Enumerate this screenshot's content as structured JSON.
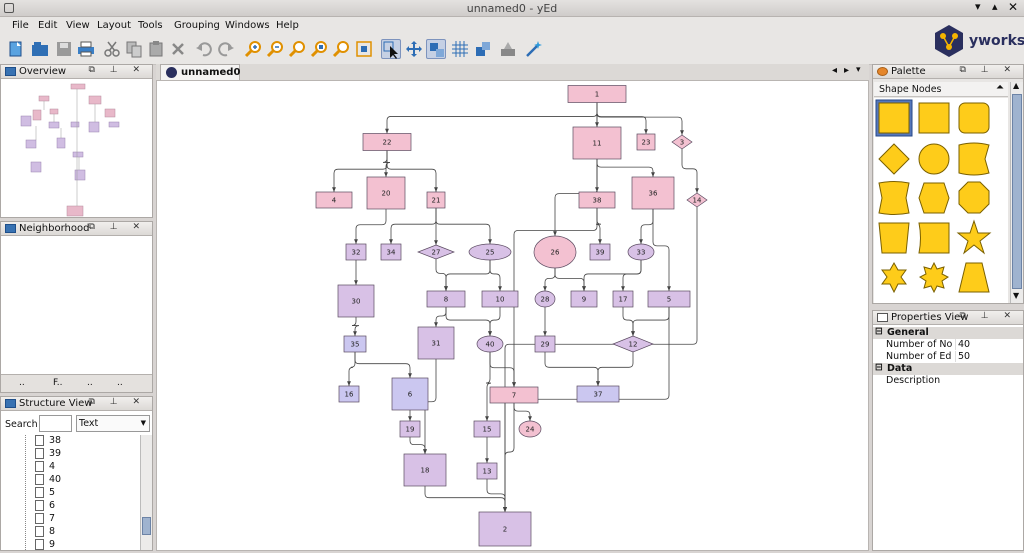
{
  "window": {
    "title": "unnamed0 - yEd"
  },
  "menu": [
    "File",
    "Edit",
    "View",
    "Layout",
    "Tools",
    "Grouping",
    "Windows",
    "Help"
  ],
  "brand": {
    "logo_text": "yworks"
  },
  "document_tab": {
    "label": "unnamed0"
  },
  "panels": {
    "overview": {
      "title": "Overview"
    },
    "neighborhood": {
      "title": "Neighborhood",
      "bottom_tabs": [
        "..",
        "F..",
        "..",
        ".."
      ]
    },
    "structure": {
      "title": "Structure View",
      "search_label": "Search",
      "search_value": "",
      "filter_value": "Text",
      "items": [
        "38",
        "39",
        "4",
        "40",
        "5",
        "6",
        "7",
        "8",
        "9"
      ]
    },
    "palette": {
      "title": "Palette",
      "section": "Shape Nodes"
    },
    "properties": {
      "title": "Properties View",
      "groups": [
        {
          "name": "General",
          "rows": [
            {
              "key": "Number of No...",
              "value": "40"
            },
            {
              "key": "Number of Ed...",
              "value": "50"
            }
          ]
        },
        {
          "name": "Data",
          "rows": [
            {
              "key": "Description",
              "value": ""
            }
          ]
        }
      ]
    }
  },
  "colors": {
    "pink": "#f3c1d1",
    "violet": "#d8c1e6",
    "blue": "#cbc7f0",
    "edge": "#444444",
    "accent": "#3872b2"
  },
  "graph": {
    "nodes": [
      {
        "id": "1",
        "shape": "rect",
        "color": "pink"
      },
      {
        "id": "22",
        "shape": "rect",
        "color": "pink"
      },
      {
        "id": "11",
        "shape": "rect",
        "color": "pink"
      },
      {
        "id": "23",
        "shape": "rect",
        "color": "pink"
      },
      {
        "id": "3",
        "shape": "diamond",
        "color": "pink"
      },
      {
        "id": "4",
        "shape": "rect",
        "color": "pink"
      },
      {
        "id": "20",
        "shape": "rect",
        "color": "pink"
      },
      {
        "id": "21",
        "shape": "rect",
        "color": "pink"
      },
      {
        "id": "38",
        "shape": "rect",
        "color": "pink"
      },
      {
        "id": "36",
        "shape": "rect",
        "color": "pink"
      },
      {
        "id": "14",
        "shape": "diamond",
        "color": "pink"
      },
      {
        "id": "32",
        "shape": "rect",
        "color": "violet"
      },
      {
        "id": "34",
        "shape": "rect",
        "color": "violet"
      },
      {
        "id": "27",
        "shape": "diamond",
        "color": "violet"
      },
      {
        "id": "25",
        "shape": "ellipse",
        "color": "violet"
      },
      {
        "id": "26",
        "shape": "ellipse",
        "color": "pink"
      },
      {
        "id": "39",
        "shape": "rect",
        "color": "violet"
      },
      {
        "id": "33",
        "shape": "ellipse",
        "color": "violet"
      },
      {
        "id": "30",
        "shape": "rect",
        "color": "violet"
      },
      {
        "id": "8",
        "shape": "rect",
        "color": "violet"
      },
      {
        "id": "10",
        "shape": "rect",
        "color": "violet"
      },
      {
        "id": "28",
        "shape": "ellipse",
        "color": "violet"
      },
      {
        "id": "9",
        "shape": "rect",
        "color": "violet"
      },
      {
        "id": "17",
        "shape": "rect",
        "color": "violet"
      },
      {
        "id": "5",
        "shape": "rect",
        "color": "violet"
      },
      {
        "id": "35",
        "shape": "rect",
        "color": "blue"
      },
      {
        "id": "31",
        "shape": "rect",
        "color": "violet"
      },
      {
        "id": "40",
        "shape": "ellipse",
        "color": "violet"
      },
      {
        "id": "29",
        "shape": "rect",
        "color": "violet"
      },
      {
        "id": "12",
        "shape": "diamond",
        "color": "violet"
      },
      {
        "id": "16",
        "shape": "rect",
        "color": "blue"
      },
      {
        "id": "6",
        "shape": "rect",
        "color": "blue"
      },
      {
        "id": "7",
        "shape": "rect",
        "color": "pink"
      },
      {
        "id": "37",
        "shape": "rect",
        "color": "blue"
      },
      {
        "id": "19",
        "shape": "rect",
        "color": "violet"
      },
      {
        "id": "15",
        "shape": "rect",
        "color": "violet"
      },
      {
        "id": "24",
        "shape": "ellipse",
        "color": "pink"
      },
      {
        "id": "18",
        "shape": "rect",
        "color": "violet"
      },
      {
        "id": "13",
        "shape": "rect",
        "color": "violet"
      },
      {
        "id": "2",
        "shape": "rect",
        "color": "violet"
      }
    ],
    "edges": [
      [
        "1",
        "22"
      ],
      [
        "1",
        "11"
      ],
      [
        "1",
        "23"
      ],
      [
        "1",
        "3"
      ],
      [
        "1",
        "7"
      ],
      [
        "22",
        "4"
      ],
      [
        "22",
        "20"
      ],
      [
        "22",
        "21"
      ],
      [
        "11",
        "26"
      ],
      [
        "11",
        "38"
      ],
      [
        "11",
        "36"
      ],
      [
        "3",
        "14"
      ],
      [
        "20",
        "32"
      ],
      [
        "21",
        "34"
      ],
      [
        "21",
        "27"
      ],
      [
        "21",
        "25"
      ],
      [
        "38",
        "39"
      ],
      [
        "36",
        "33"
      ],
      [
        "36",
        "5"
      ],
      [
        "32",
        "30"
      ],
      [
        "30",
        "35"
      ],
      [
        "35",
        "16"
      ],
      [
        "35",
        "6"
      ],
      [
        "27",
        "8"
      ],
      [
        "25",
        "8"
      ],
      [
        "25",
        "10"
      ],
      [
        "8",
        "40"
      ],
      [
        "10",
        "40"
      ],
      [
        "8",
        "31"
      ],
      [
        "26",
        "28"
      ],
      [
        "26",
        "9"
      ],
      [
        "33",
        "9"
      ],
      [
        "33",
        "17"
      ],
      [
        "28",
        "29"
      ],
      [
        "29",
        "37"
      ],
      [
        "17",
        "12"
      ],
      [
        "5",
        "12"
      ],
      [
        "12",
        "37"
      ],
      [
        "40",
        "7"
      ],
      [
        "40",
        "15"
      ],
      [
        "7",
        "24"
      ],
      [
        "7",
        "2"
      ],
      [
        "6",
        "19"
      ],
      [
        "19",
        "18"
      ],
      [
        "31",
        "18"
      ],
      [
        "18",
        "2"
      ],
      [
        "15",
        "13"
      ],
      [
        "13",
        "2"
      ],
      [
        "5",
        "2"
      ],
      [
        "14",
        "2"
      ]
    ]
  }
}
